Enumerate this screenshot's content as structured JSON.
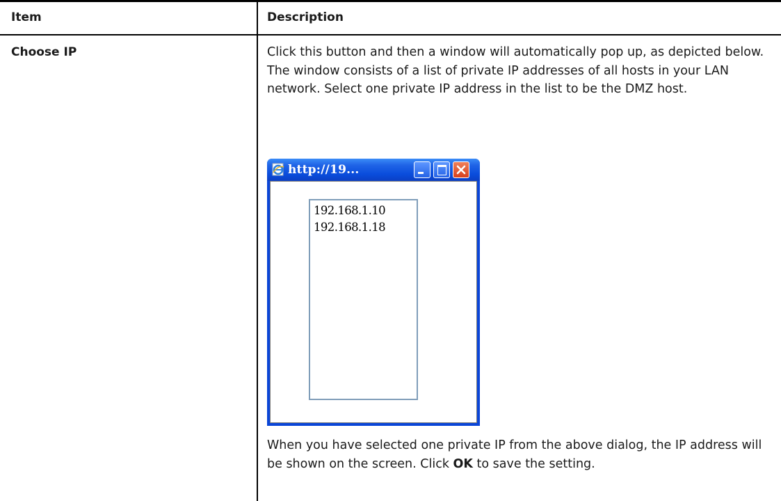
{
  "table": {
    "header": {
      "item": "Item",
      "description": "Description"
    },
    "row": {
      "item": "Choose IP",
      "description_1": "Click this button and then a window will automatically pop up, as depicted below. The window consists of a list of private IP addresses of all hosts in your LAN network. Select one private IP address in the list to be the DMZ host.",
      "description_2_before": "When you have selected one private IP from the above dialog, the IP address will be shown on the screen. Click ",
      "description_2_bold": "OK",
      "description_2_after": " to save the setting."
    }
  },
  "popup": {
    "title": "http://19...",
    "ip_options": [
      "192.168.1.10",
      "192.168.1.18"
    ]
  },
  "colors": {
    "title_bar": "#0a4ddc",
    "close_button": "#d7401c",
    "list_border": "#7f9db9"
  }
}
